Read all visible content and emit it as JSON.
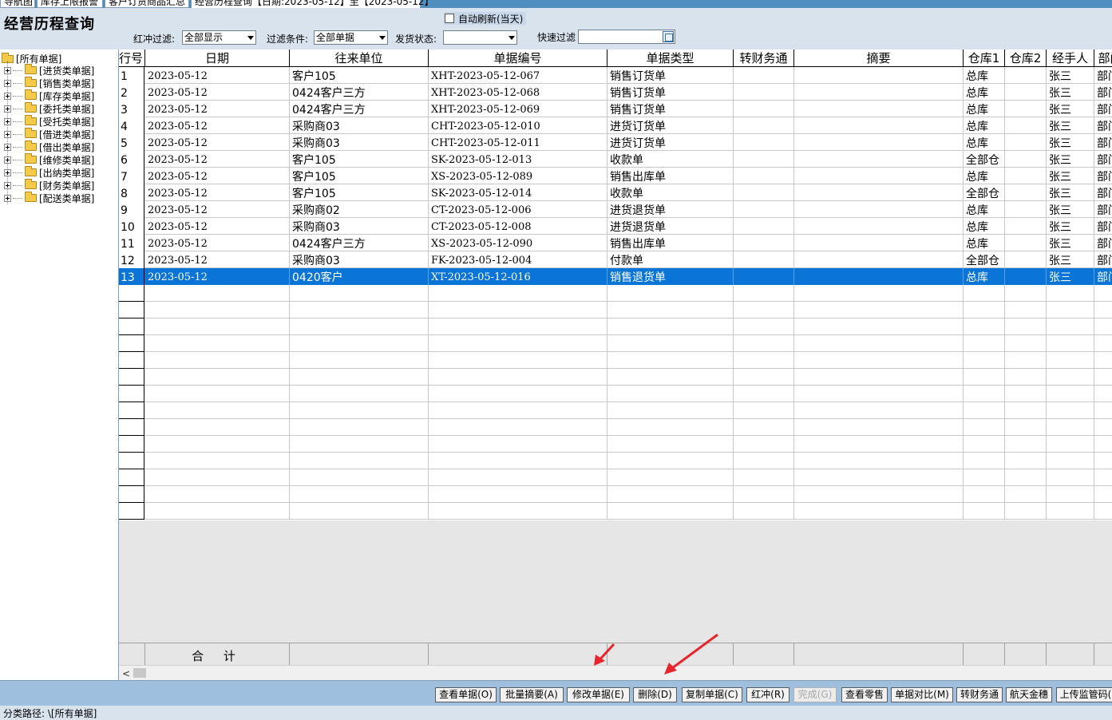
{
  "tabs": [
    {
      "label": "导航图"
    },
    {
      "label": "库存上限报警"
    },
    {
      "label": "客户订货商品汇总"
    },
    {
      "label": "经营历程查询【日期:2023-05-12】至【2023-05-12】"
    }
  ],
  "header": {
    "title": "经营历程查询",
    "auto_refresh_label": "自动刷新(当天)",
    "redflush_label": "红冲过滤:",
    "redflush_value": "全部显示",
    "filter_label": "过滤条件:",
    "filter_value": "全部单据",
    "ship_label": "发货状态:",
    "ship_value": "",
    "quick_label": "快速过滤",
    "quick_value": ""
  },
  "tree": {
    "root": "[所有单据]",
    "items": [
      "[进货类单据]",
      "[销售类单据]",
      "[库存类单据]",
      "[委托类单据]",
      "[受托类单据]",
      "[借进类单据]",
      "[借出类单据]",
      "[维修类单据]",
      "[出纳类单据]",
      "[财务类单据]",
      "[配送类单据]"
    ]
  },
  "grid": {
    "columns": [
      "行号",
      "日期",
      "往来单位",
      "单据编号",
      "单据类型",
      "转财务通",
      "摘要",
      "仓库1",
      "仓库2",
      "经手人",
      "部门"
    ],
    "rows": [
      [
        "1",
        "2023-05-12",
        "客户105",
        "XHT-2023-05-12-067",
        "销售订货单",
        "",
        "",
        "总库",
        "",
        "张三",
        "部门"
      ],
      [
        "2",
        "2023-05-12",
        "0424客户三方",
        "XHT-2023-05-12-068",
        "销售订货单",
        "",
        "",
        "总库",
        "",
        "张三",
        "部门"
      ],
      [
        "3",
        "2023-05-12",
        "0424客户三方",
        "XHT-2023-05-12-069",
        "销售订货单",
        "",
        "",
        "总库",
        "",
        "张三",
        "部门"
      ],
      [
        "4",
        "2023-05-12",
        "采购商03",
        "CHT-2023-05-12-010",
        "进货订货单",
        "",
        "",
        "总库",
        "",
        "张三",
        "部门"
      ],
      [
        "5",
        "2023-05-12",
        "采购商03",
        "CHT-2023-05-12-011",
        "进货订货单",
        "",
        "",
        "总库",
        "",
        "张三",
        "部门"
      ],
      [
        "6",
        "2023-05-12",
        "客户105",
        "SK-2023-05-12-013",
        "收款单",
        "",
        "",
        "全部仓",
        "",
        "张三",
        "部门"
      ],
      [
        "7",
        "2023-05-12",
        "客户105",
        "XS-2023-05-12-089",
        "销售出库单",
        "",
        "",
        "总库",
        "",
        "张三",
        "部门"
      ],
      [
        "8",
        "2023-05-12",
        "客户105",
        "SK-2023-05-12-014",
        "收款单",
        "",
        "",
        "全部仓",
        "",
        "张三",
        "部门"
      ],
      [
        "9",
        "2023-05-12",
        "采购商02",
        "CT-2023-05-12-006",
        "进货退货单",
        "",
        "",
        "总库",
        "",
        "张三",
        "部门"
      ],
      [
        "10",
        "2023-05-12",
        "采购商03",
        "CT-2023-05-12-008",
        "进货退货单",
        "",
        "",
        "总库",
        "",
        "张三",
        "部门"
      ],
      [
        "11",
        "2023-05-12",
        "0424客户三方",
        "XS-2023-05-12-090",
        "销售出库单",
        "",
        "",
        "总库",
        "",
        "张三",
        "部门"
      ],
      [
        "12",
        "2023-05-12",
        "采购商03",
        "FK-2023-05-12-004",
        "付款单",
        "",
        "",
        "全部仓",
        "",
        "张三",
        "部门"
      ],
      [
        "13",
        "2023-05-12",
        "0420客户",
        "XT-2023-05-12-016",
        "销售退货单",
        "",
        "",
        "总库",
        "",
        "张三",
        "部门"
      ]
    ],
    "selected_row": 13,
    "sum_label": "合 计"
  },
  "toolbar": {
    "buttons": [
      {
        "label": "查看单据(O)",
        "enabled": true
      },
      {
        "label": "批量摘要(A)",
        "enabled": true
      },
      {
        "label": "修改单据(E)",
        "enabled": true
      },
      {
        "label": "删除(D)",
        "enabled": true
      },
      {
        "label": "复制单据(C)",
        "enabled": true
      },
      {
        "label": "红冲(R)",
        "enabled": true
      },
      {
        "label": "完成(G)",
        "enabled": false
      },
      {
        "label": "查看零售",
        "enabled": true
      },
      {
        "label": "单据对比(M)",
        "enabled": true
      },
      {
        "label": "转财务通",
        "enabled": true
      },
      {
        "label": "航天金穗",
        "enabled": true
      },
      {
        "label": "上传监管码(",
        "enabled": true
      }
    ]
  },
  "status": {
    "path_label": "分类路径:",
    "path_value": "\\[所有单据]"
  },
  "colors": {
    "selection": "#0a75d6",
    "toolbar_bg": "#9fbfdf",
    "annotation_arrow": "#e8252c"
  }
}
